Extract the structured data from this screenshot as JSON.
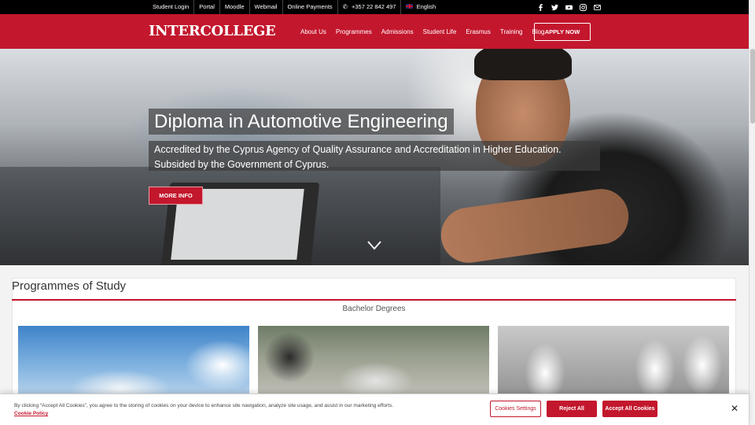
{
  "topbar": {
    "links": [
      "Student Login",
      "Portal",
      "Moodle",
      "Webmail",
      "Online Payments"
    ],
    "phone": "+357 22 842 497",
    "language": "English",
    "social_icons": [
      "facebook-icon",
      "twitter-icon",
      "youtube-icon",
      "instagram-icon",
      "envelope-icon"
    ]
  },
  "header": {
    "logo": "INTERCOLLEGE",
    "nav": [
      "About Us",
      "Programmes",
      "Admissions",
      "Student Life",
      "Erasmus",
      "Training",
      "Blog"
    ],
    "apply_label": "APPLY NOW"
  },
  "hero": {
    "title": "Diploma in Automotive Engineering",
    "subtitle": "Accredited by the Cyprus Agency of Quality Assurance and Accreditation in Higher Education. Subsided by the Government of Cyprus.",
    "button_label": "MORE INFO"
  },
  "programmes": {
    "title": "Programmes of Study",
    "tab": "Bachelor Degrees"
  },
  "cookie": {
    "text": "By clicking “Accept All Cookies”, you agree to the storing of cookies on your device to enhance site navigation, analyze site usage, and assist in our marketing efforts.",
    "policy_link": "Cookie Policy",
    "settings_label": "Cookies Settings",
    "reject_label": "Reject All",
    "accept_label": "Accept All Cookies",
    "close_icon": "close-icon"
  },
  "colors": {
    "brand_red": "#c3172d",
    "topbar_black": "#000000"
  }
}
